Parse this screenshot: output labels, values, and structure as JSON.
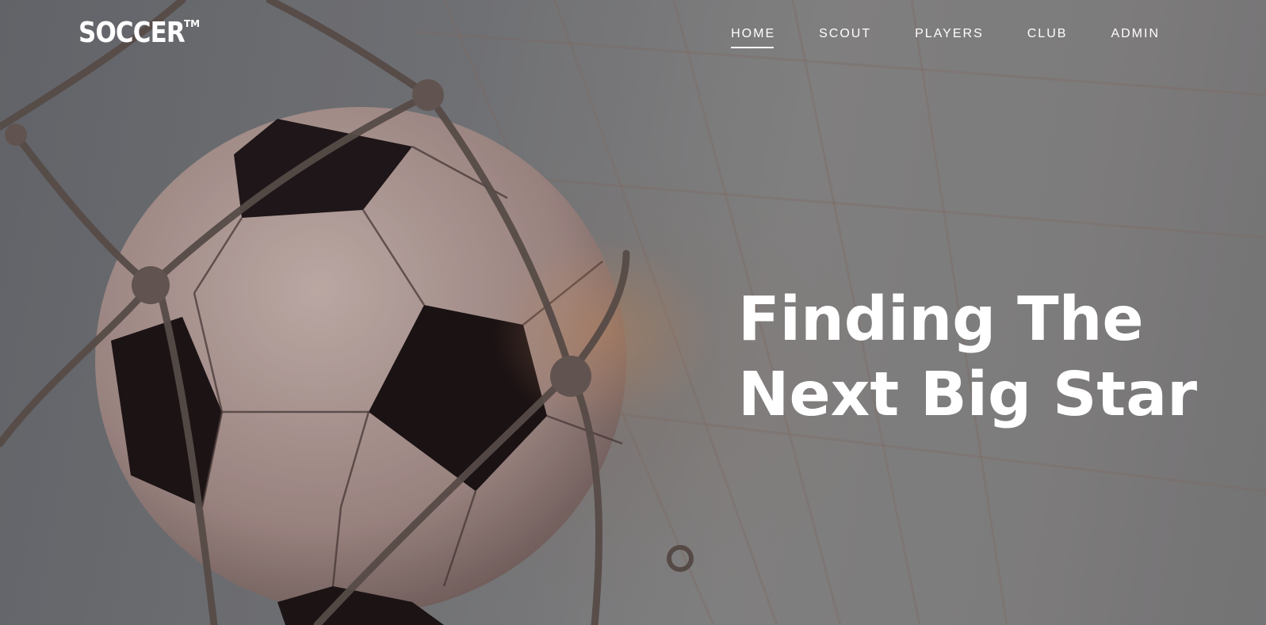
{
  "brand": {
    "name": "SOCCER",
    "trademark": "TM"
  },
  "nav": {
    "items": [
      {
        "label": "HOME",
        "active": true
      },
      {
        "label": "SCOUT",
        "active": false
      },
      {
        "label": "PLAYERS",
        "active": false
      },
      {
        "label": "CLUB",
        "active": false
      },
      {
        "label": "ADMIN",
        "active": false
      }
    ]
  },
  "hero": {
    "headline_line1": "Finding The",
    "headline_line2": "Next Big Star",
    "image_subject": "soccer-ball-in-net"
  },
  "colors": {
    "text": "#ffffff",
    "ball_light": "#c9b5b0",
    "ball_dark": "#1b1416",
    "net": "#6f625c"
  }
}
